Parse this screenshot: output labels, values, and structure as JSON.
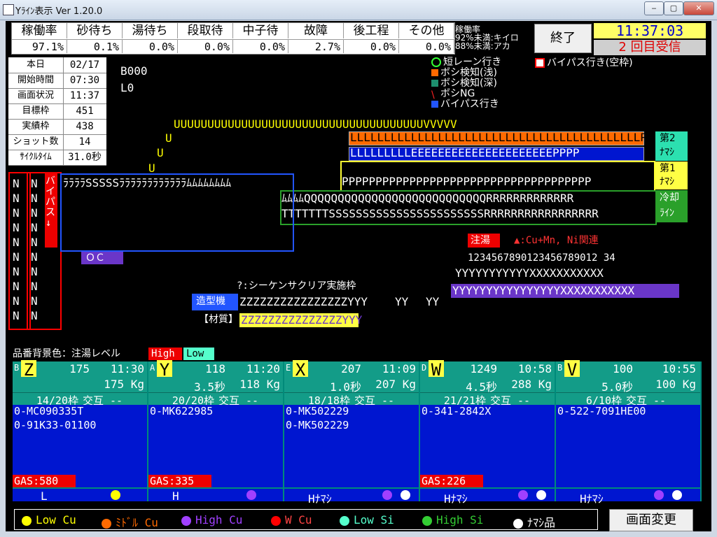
{
  "window": {
    "title": "Yﾗｲﾝ表示 Ver 1.20.0",
    "btn_min": "‒",
    "btn_max": "▢",
    "btn_close": "✕"
  },
  "top": {
    "headers": [
      "稼働率",
      "砂待ち",
      "湯待ち",
      "段取待",
      "中子待",
      "故障",
      "後工程",
      "その他"
    ],
    "values": [
      "97.1%",
      "0.1%",
      "0.0%",
      "0.0%",
      "0.0%",
      "2.7%",
      "0.0%",
      "0.0%"
    ],
    "legend_lines": [
      "稼働率",
      "92%未満:キイロ",
      "88%未満:アカ"
    ],
    "end_button": "終了",
    "clock": "11:37:03",
    "recv": "2 回目受信"
  },
  "info": {
    "rows": [
      {
        "k": "本日",
        "v": "02/17"
      },
      {
        "k": "開始時間",
        "v": "07:30"
      },
      {
        "k": "画面状況",
        "v": "11:37"
      },
      {
        "k": "目標枠",
        "v": "451"
      },
      {
        "k": "実績枠",
        "v": "438"
      },
      {
        "k": "ショット数",
        "v": "14"
      },
      {
        "k": "ｻｲｸﾙﾀｲﾑ",
        "v": "31.0秒"
      }
    ]
  },
  "line": {
    "b": "B000",
    "l": "L0",
    "legend": [
      "短レーン行き",
      "ボシ検知(浅)",
      "ボシ検知(深)",
      "ボシNG",
      "バイパス行き"
    ],
    "bypass_empty": "バイパス行き(空枠)",
    "cu_note": "▲:Cu+Mn, Ni関連",
    "pour": "注湯",
    "seq": "1234567890123456789012 34",
    "seq_clear": "?:シーケンサクリア実施枠",
    "molder": "造型機",
    "material": "【材質】",
    "oc": "ＯＣ",
    "bypass_label": "バイパス↓",
    "nama2": "第2",
    "nama2b": "ﾅﾏｼ",
    "nama1": "第1",
    "nama1b": "ﾅﾏｼ",
    "cool": "冷却",
    "coolb": "ﾗｲﾝ",
    "product_bg": "品番背景色：注湯レベル",
    "high": "High",
    "low": "Low",
    "row_u": "UUUUUUUUUUUUUUUUUUUUUUUUUUUUUUUUUUUUUVVVVV",
    "row_y_top": "YYYYYYYYYYYXXXXXXXXXXX",
    "row_y_purple": "YYYYYYYYYYYYYYYYXXXXXXXXXXX",
    "row_z": "ZZZZZZZZZZZZZZZZYYY",
    "row_z2": "ZZZZZZZZZZZZZZZYYY",
    "row_yy1": "YY",
    "row_yy2": "YY",
    "row_p": "PPPPPPPPPPPPPPPPPPPPPPPPPPPPPPPPPPPPP",
    "row_q": "ﾑﾑﾑﾑQQQQQQQQQQQQQQQQQQQQQQQQQQQRRRRRRRRRRRRR",
    "row_t": "TTTTTTTSSSSSSSSSSSSSSSSSSSSSSSRRRRRRRRRRRRRRRRR",
    "row_l1": "LLLLLLLLLLLLLLLLLLLLLLLLLLLLLLLLLLLLLLLLLLLPP",
    "row_l2": "LLLLLLLLLEEEEEEEEEEEEEEEEEEEEEPPPP",
    "row_ra": "ﾗﾗﾗﾗSSSSSﾗﾗﾗﾗﾗﾗﾗﾗﾗﾗﾗﾗﾑﾑﾑﾑﾑﾑﾑﾑ"
  },
  "cards": [
    {
      "letter": "Z",
      "sub": "B",
      "count": "175",
      "time": "11:30",
      "weight": "175 Kg",
      "frames": "14/20枠",
      "mode": "交互 --",
      "items": [
        "0-MC090335T",
        "0-91K33-01100"
      ],
      "gas": "GAS:580",
      "bottom": "L",
      "dots": [
        "#ffff00"
      ]
    },
    {
      "letter": "Y",
      "sub": "A",
      "count": "118",
      "time": "11:20",
      "sec": "3.5秒",
      "weight": "118 Kg",
      "frames": "20/20枠",
      "mode": "交互 --",
      "items": [
        "0-MK622985"
      ],
      "gas": "GAS:335",
      "bottom": "H",
      "dots": [
        "#a040ff"
      ]
    },
    {
      "letter": "X",
      "sub": "E",
      "count": "207",
      "time": "11:09",
      "sec": "1.0秒",
      "weight": "207 Kg",
      "frames": "18/18枠",
      "mode": "交互 --",
      "items": [
        "0-MK502229",
        "0-MK502229"
      ],
      "gas": "",
      "bottom": "Hﾅﾏｼ",
      "dots": [
        "#a040ff",
        "#ffffff"
      ]
    },
    {
      "letter": "W",
      "sub": "D",
      "count": "1249",
      "time": "10:58",
      "sec": "4.5秒",
      "weight": "288 Kg",
      "frames": "21/21枠",
      "mode": "交互 --",
      "items": [
        "0-341-2842X"
      ],
      "gas": "GAS:226",
      "bottom": "Hﾅﾏｼ",
      "dots": [
        "#a040ff",
        "#ffffff"
      ]
    },
    {
      "letter": "V",
      "sub": "B",
      "count": "100",
      "time": "10:55",
      "sec": "5.0秒",
      "weight": "100 Kg",
      "frames": "6/10枠",
      "mode": "交互 --",
      "items": [
        "0-522-7091HE00"
      ],
      "gas": "",
      "bottom": "Hﾅﾏｼ",
      "dots": [
        "#a040ff",
        "#ffffff"
      ]
    }
  ],
  "bottom_legend": [
    {
      "label": "Low Cu",
      "color": "#ffff00"
    },
    {
      "label": "ﾐﾄﾞﾙ Cu",
      "color": "#ff6a00"
    },
    {
      "label": "High Cu",
      "color": "#a040ff"
    },
    {
      "label": "W Cu",
      "color": "#ff0000"
    },
    {
      "label": "Low Si",
      "color": "#55ffcc"
    },
    {
      "label": "High Si",
      "color": "#33cc33"
    },
    {
      "label": "ﾅﾏｼ品",
      "color": "#ffffff"
    }
  ],
  "change_screen": "画面変更"
}
